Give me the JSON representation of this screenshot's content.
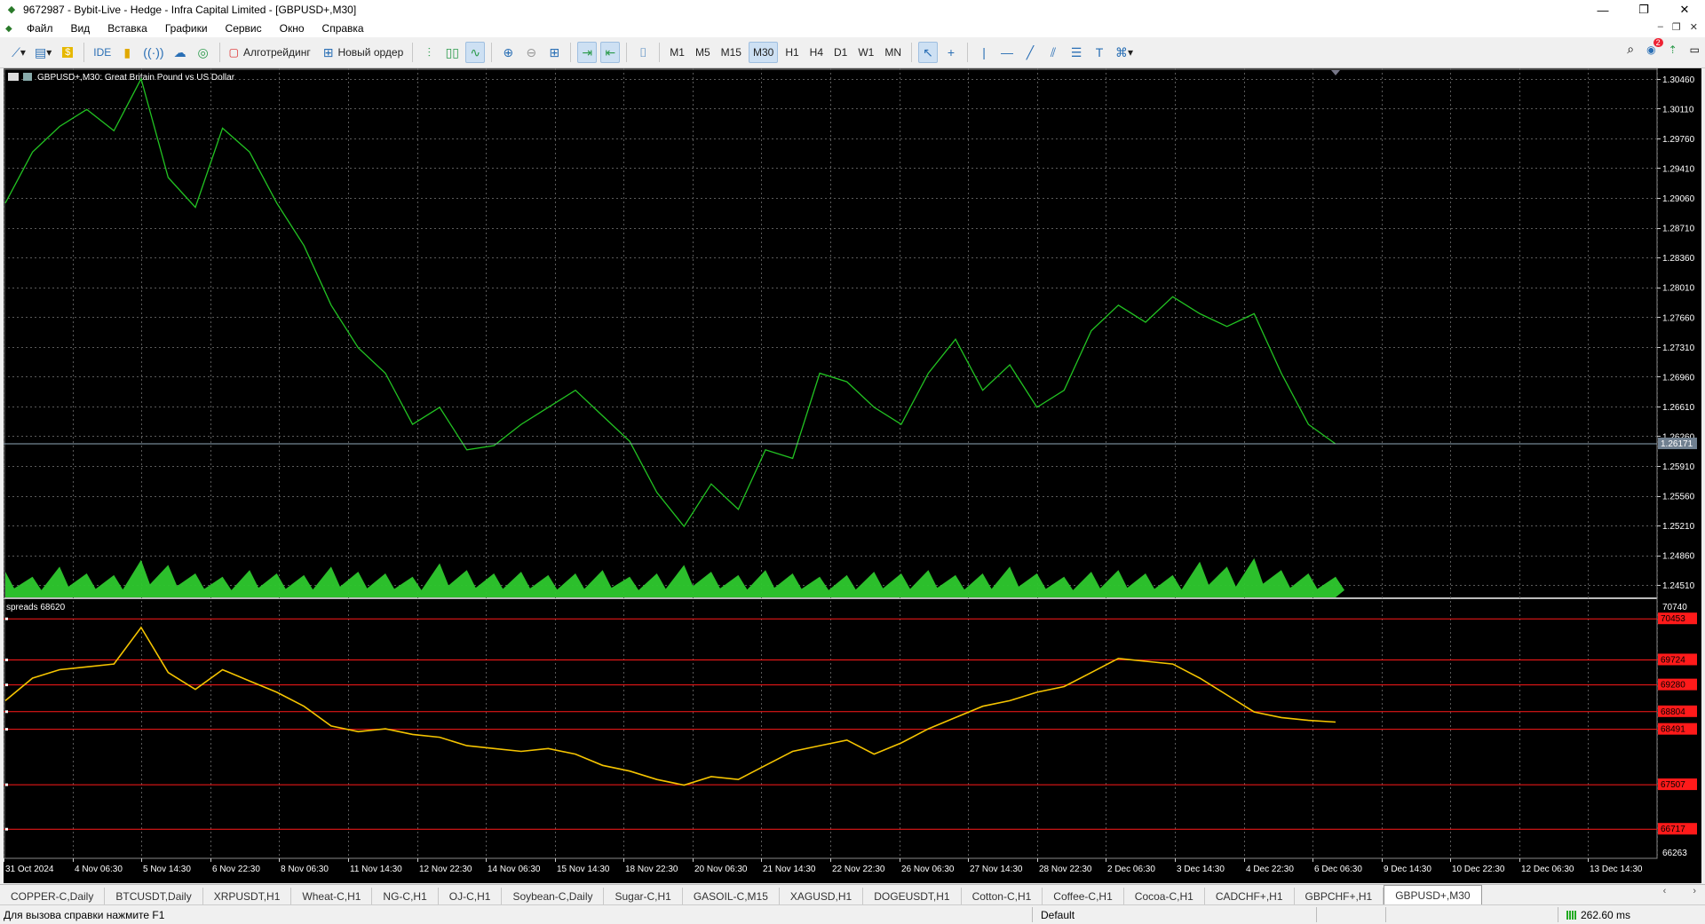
{
  "window": {
    "title": "9672987 - Bybit-Live - Hedge - Infra Capital Limited - [GBPUSD+,M30]",
    "controls": [
      "—",
      "❐",
      "✕"
    ]
  },
  "menu": [
    "Файл",
    "Вид",
    "Вставка",
    "Графики",
    "Сервис",
    "Окно",
    "Справка"
  ],
  "toolbar": {
    "ide_label": "IDE",
    "algo_label": "Алготрейдинг",
    "new_order_label": "Новый ордер",
    "timeframes": [
      "M1",
      "M5",
      "M15",
      "M30",
      "H1",
      "H4",
      "D1",
      "W1",
      "MN"
    ],
    "active_timeframe": "M30",
    "notifications_count": "2"
  },
  "chart": {
    "title": "GBPUSD+,M30:  Great Britain Pound vs US Dollar",
    "price_labels": [
      "1.30460",
      "1.30110",
      "1.29760",
      "1.29410",
      "1.29060",
      "1.28710",
      "1.28360",
      "1.28010",
      "1.27660",
      "1.27310",
      "1.26960",
      "1.26610",
      "1.26260",
      "1.25910",
      "1.25560",
      "1.25210",
      "1.24860",
      "1.24510"
    ],
    "current_price": "1.26171",
    "indicator": {
      "title": "spreads 68620",
      "top_label": "70740",
      "bottom_label": "66263",
      "levels": [
        "70453",
        "69724",
        "69280",
        "68804",
        "68491",
        "67507",
        "66717"
      ]
    },
    "time_labels": [
      "31 Oct 2024",
      "4 Nov 06:30",
      "5 Nov 14:30",
      "6 Nov 22:30",
      "8 Nov 06:30",
      "11 Nov 14:30",
      "12 Nov 22:30",
      "14 Nov 06:30",
      "15 Nov 14:30",
      "18 Nov 22:30",
      "20 Nov 06:30",
      "21 Nov 14:30",
      "22 Nov 22:30",
      "26 Nov 06:30",
      "27 Nov 14:30",
      "28 Nov 22:30",
      "2 Dec 06:30",
      "3 Dec 14:30",
      "4 Dec 22:30",
      "6 Dec 06:30",
      "9 Dec 14:30",
      "10 Dec 22:30",
      "12 Dec 06:30",
      "13 Dec 14:30"
    ],
    "colors": {
      "price": "#22c322",
      "volume": "#2ec92e",
      "indicator": "#f5c400",
      "level": "#ff1a1a",
      "grid": "#5a5a5a"
    }
  },
  "chart_data": {
    "type": "line",
    "series": [
      {
        "values": [
          1.29,
          1.296,
          1.299,
          1.301,
          1.2985,
          1.3046,
          1.293,
          1.2895,
          1.2988,
          1.296,
          1.29,
          1.285,
          1.278,
          1.273,
          1.27,
          1.264,
          1.266,
          1.261,
          1.2615,
          1.264,
          1.266,
          1.268,
          1.265,
          1.262,
          1.256,
          1.252,
          1.257,
          1.254,
          1.261,
          1.26,
          1.27,
          1.269,
          1.266,
          1.264,
          1.27,
          1.274,
          1.268,
          1.271,
          1.266,
          1.268,
          1.275,
          1.278,
          1.276,
          1.279,
          1.277,
          1.2755,
          1.277,
          1.27,
          1.264,
          1.2617
        ]
      }
    ],
    "indicator_values": [
      69000,
      69400,
      69550,
      69600,
      69650,
      70300,
      69500,
      69200,
      69550,
      69350,
      69150,
      68900,
      68550,
      68450,
      68500,
      68400,
      68350,
      68200,
      68150,
      68100,
      68150,
      68050,
      67850,
      67750,
      67600,
      67500,
      67650,
      67600,
      67850,
      68100,
      68200,
      68300,
      68050,
      68250,
      68500,
      68700,
      68900,
      69000,
      69150,
      69250,
      69500,
      69750,
      69700,
      69650,
      69400,
      69100,
      68800,
      68700,
      68650,
      68620
    ],
    "ylim": [
      1.2445,
      1.305
    ],
    "indicator_ylim": [
      66263,
      70740
    ]
  },
  "tabs": [
    "COPPER-C,Daily",
    "BTCUSDT,Daily",
    "XRPUSDT,H1",
    "Wheat-C,H1",
    "NG-C,H1",
    "OJ-C,H1",
    "Soybean-C,Daily",
    "Sugar-C,H1",
    "GASOIL-C,M15",
    "XAGUSD,H1",
    "DOGEUSDT,H1",
    "Cotton-C,H1",
    "Coffee-C,H1",
    "Cocoa-C,H1",
    "CADCHF+,H1",
    "GBPCHF+,H1",
    "GBPUSD+,M30"
  ],
  "active_tab": "GBPUSD+,M30",
  "status": {
    "help": "Для вызова справки нажмите F1",
    "profile": "Default",
    "ping": "262.60 ms"
  }
}
